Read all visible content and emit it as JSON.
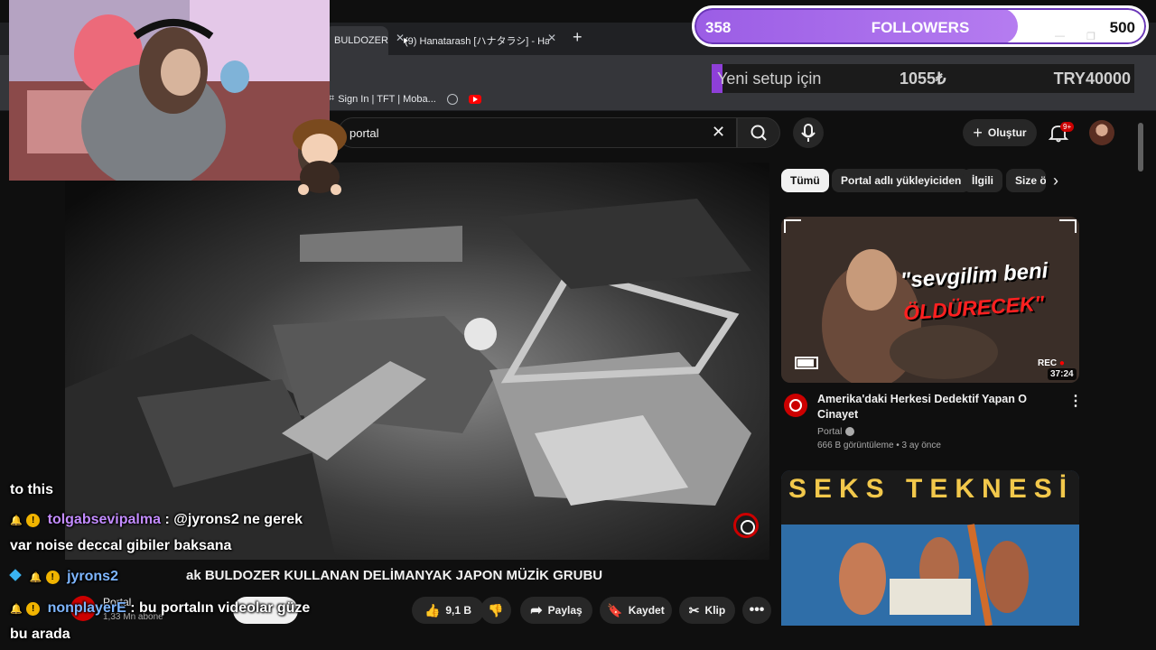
{
  "browser": {
    "tabs": [
      {
        "label": "BULDOZER"
      },
      {
        "label": "(9) Hanatarash [ハナタラシ] - Han"
      }
    ],
    "bookmarks": [
      {
        "label": "Sign In | TFT | Moba..."
      }
    ]
  },
  "youtube": {
    "search": {
      "query": "portal"
    },
    "create_label": "Oluştur",
    "notifications_badge": "9+",
    "video": {
      "title": "BULDOZER KULLANAN DELİMANYAK JAPON MÜZİK GRUBU",
      "title_partial": "ak BULDOZER KULLANAN DELİMANYAK JAPON MÜZİK GRUBU",
      "channel": "Portal",
      "subscribers": "1,33 Mn abone",
      "likes": "9,1 B",
      "share_label": "Paylaş",
      "save_label": "Kaydet",
      "clip_label": "Klip"
    },
    "chips": [
      "Tümü",
      "Portal adlı yükleyiciden",
      "İlgili",
      "Size ö"
    ],
    "related": [
      {
        "thumb_text_1": "\"sevgilim beni",
        "thumb_text_2": "ÖLDÜRECEK\"",
        "rec_label": "REC",
        "duration": "37:24",
        "title": "Amerika'daki Herkesi Dedektif Yapan O Cinayet",
        "channel": "Portal",
        "meta": "666 B görüntüleme • 3 ay önce"
      },
      {
        "thumb_text_1": "SEKS TEKNESİ"
      }
    ]
  },
  "overlay": {
    "followers": {
      "current": "358",
      "label": "FOLLOWERS",
      "goal": "500",
      "progress": 0.716
    },
    "donation": {
      "label": "Yeni setup için",
      "current": "1055₺",
      "goal": "TRY40000",
      "progress": 0.026
    },
    "chat": [
      {
        "text": "to this"
      },
      {
        "user": "tolgabsevipalma",
        "text": ": @jyrons2 ne gerek"
      },
      {
        "text": "var noise deccal gibiler baksana"
      },
      {
        "user": "jyrons2"
      },
      {
        "user": "nonplayerE",
        "text": ": bu portalın videolar güze"
      },
      {
        "text": "bu arada"
      }
    ]
  },
  "colors": {
    "accent": "#9b5de5",
    "youtube_red": "#cc0000",
    "background": "#0f0f0f"
  }
}
